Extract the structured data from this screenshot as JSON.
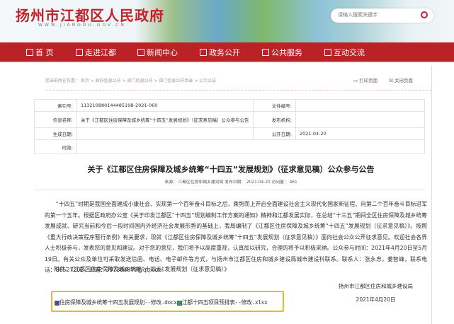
{
  "header": {
    "logo": "扬州市江都区人民政府",
    "url": "WWW.JIANGDU.GOV.CN",
    "search_placeholder": "请输入搜索关键字"
  },
  "nav": [
    {
      "label": "首 页",
      "icon": "home-icon"
    },
    {
      "label": "走进江都",
      "icon": "badge-icon"
    },
    {
      "label": "新闻中心",
      "icon": "news-icon"
    },
    {
      "label": "政务公开",
      "icon": "open-icon"
    },
    {
      "label": "公共服务",
      "icon": "briefcase-icon"
    },
    {
      "label": "互动交流",
      "icon": "chat-icon"
    }
  ],
  "breadcrumb": "您当前所在位置： 首页 > 政府信息公开 > 部门信息公开 > 部门信息公开目录 > 公示公告",
  "tools": {
    "print": "打印页面",
    "close": "关闭页面"
  },
  "info": {
    "index_label": "索引号:",
    "index": "11321088014448519B-2021-060",
    "docno_label": "文件编号:",
    "docno": "",
    "name_label": "信息名称:",
    "name": "关于《江都区住房保障及城乡统筹“十四五”发展规划》（征求意见稿）公众参与公告",
    "org_label": "发布机构:",
    "org": "",
    "created_label": "生成日期:",
    "created": "",
    "pub_label": "公开日期:",
    "pub": "2021-04-20",
    "valid_label": "时效:",
    "valid": ""
  },
  "article": {
    "title": "关于《江都区住房保障及城乡统筹“十四五”发展规划》（征求意见稿）公众参与公告",
    "meta": "来源： 江都区住房和城乡建设局 发布日期： 2021-04-20 访问量： 461",
    "body": "“十四五”时期是我国全面建成小康社会、实现第一个百年奋斗目标之后，乘势而上开启全面建设社会主义现代化国家新征程、向第二个百年奋斗目标进军的第一个五年。根据区政府办公室《关于印发江都区“十四五”规划编制工作方案的通知》精神和江都发展实际，在总结“十三五”期间全区住房保障及城乡统筹发展成就、研究当前和今后一段时间国内外经济社会发展形势的基础上，我局编制了《江都区住房保障及城乡统筹“十四五”发展规划（征求意见稿）》。按照《重大行政决策程序暂行条例》有关要求，现就《江都区住房保障及城乡统筹“十四五”发展规划（征求意见稿）》面向社会公众公开征求意见。欢迎社会各界人士积极参与，发表您的意见和建议。对于您的意见，我们将予以高度重视，认真加以研究，合理的将予以积极采纳。公众参与时间：2021年4月20日至5月19日。有关公众及单位可采取发送信函、电话、电子邮件等方式，与扬州市江都区住房和城乡建设局城市建设科联系。联系人：张永忠，姜智峰，联系电话：86527202，邮箱：397384878@qq.com",
    "annex": "附件：《江都区住房保障及城乡统筹“十四五”发展规划（征求意见稿）》",
    "signer": "扬州市江都区住房和城乡建设局",
    "date": "2021年4月20日",
    "attachments": [
      "住房保障及城乡统筹十四五发展规划--修改.docx",
      "江都十四五项目预排表--修改.xlsx"
    ]
  },
  "colors": {
    "brand": "#bb2226",
    "highlight": "#f2b624"
  }
}
